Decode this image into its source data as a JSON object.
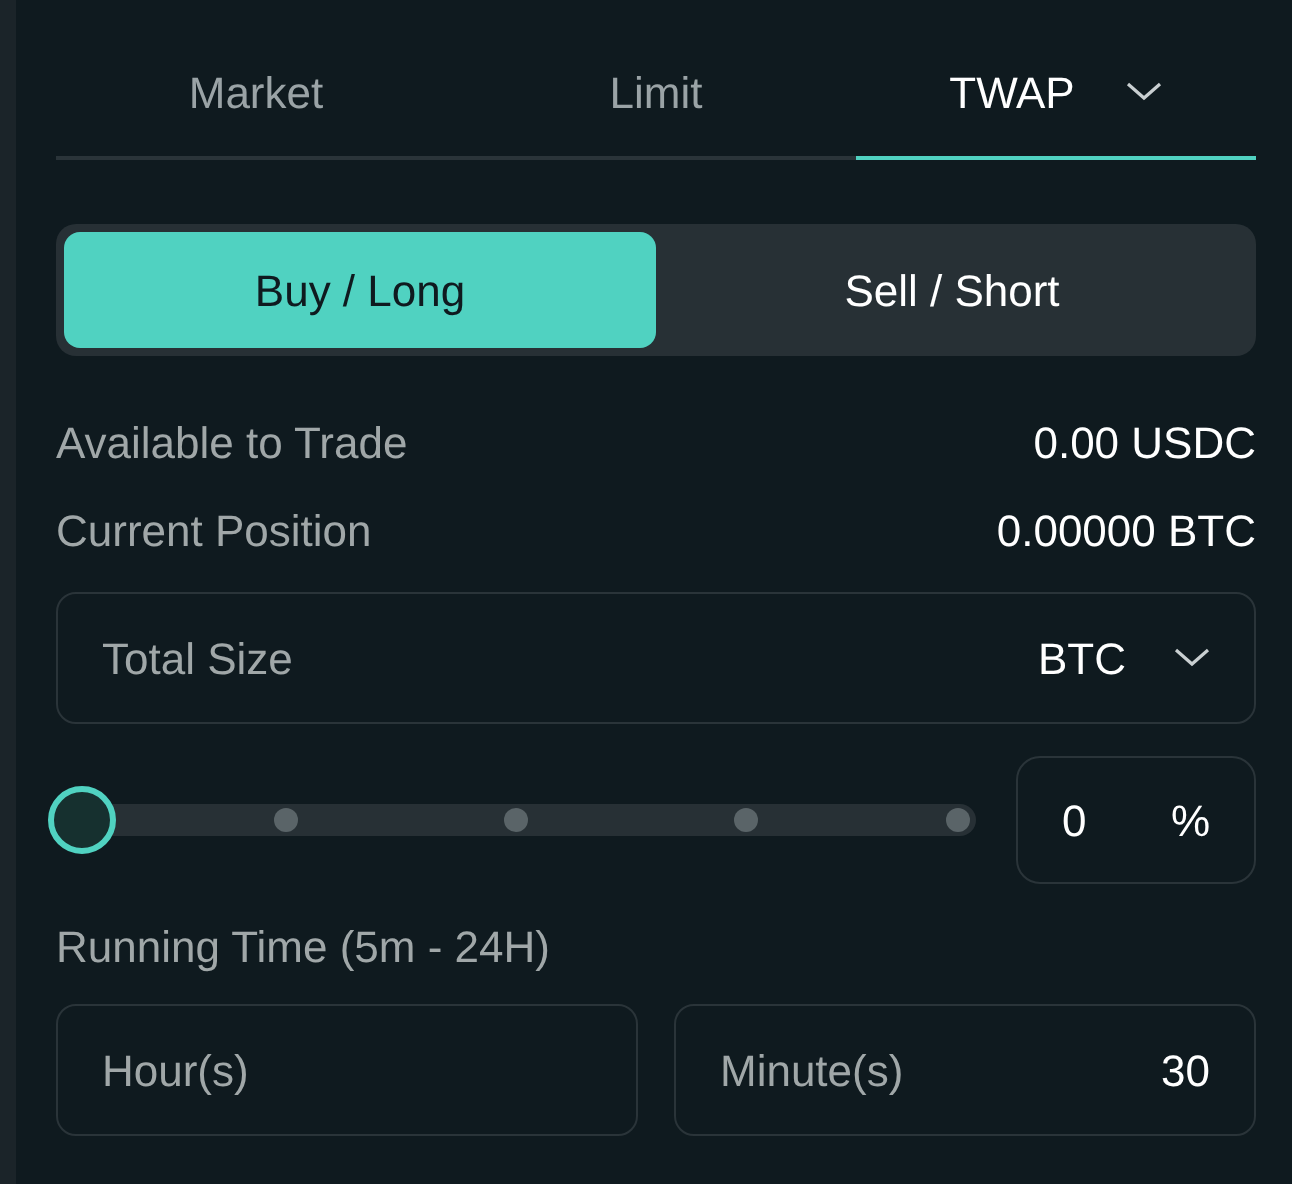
{
  "order_tabs": [
    {
      "label": "Market",
      "selected": false,
      "dropdown": false
    },
    {
      "label": "Limit",
      "selected": false,
      "dropdown": false
    },
    {
      "label": "TWAP",
      "selected": true,
      "dropdown": true
    }
  ],
  "side_toggle": [
    {
      "label": "Buy / Long",
      "selected": true
    },
    {
      "label": "Sell / Short",
      "selected": false
    }
  ],
  "info_rows": [
    {
      "label": "Available to Trade",
      "value": "0.00 USDC"
    },
    {
      "label": "Current Position",
      "value": "0.00000 BTC"
    }
  ],
  "size_field": {
    "label": "Total Size",
    "unit": "BTC"
  },
  "size_slider": {
    "level": 0,
    "percent_value": "0",
    "percent_unit": "%"
  },
  "running_time": {
    "label": "Running Time (5m - 24H)",
    "fields": [
      {
        "label": "Hour(s)"
      },
      {
        "label": "Minute(s)",
        "value": "30"
      }
    ]
  }
}
